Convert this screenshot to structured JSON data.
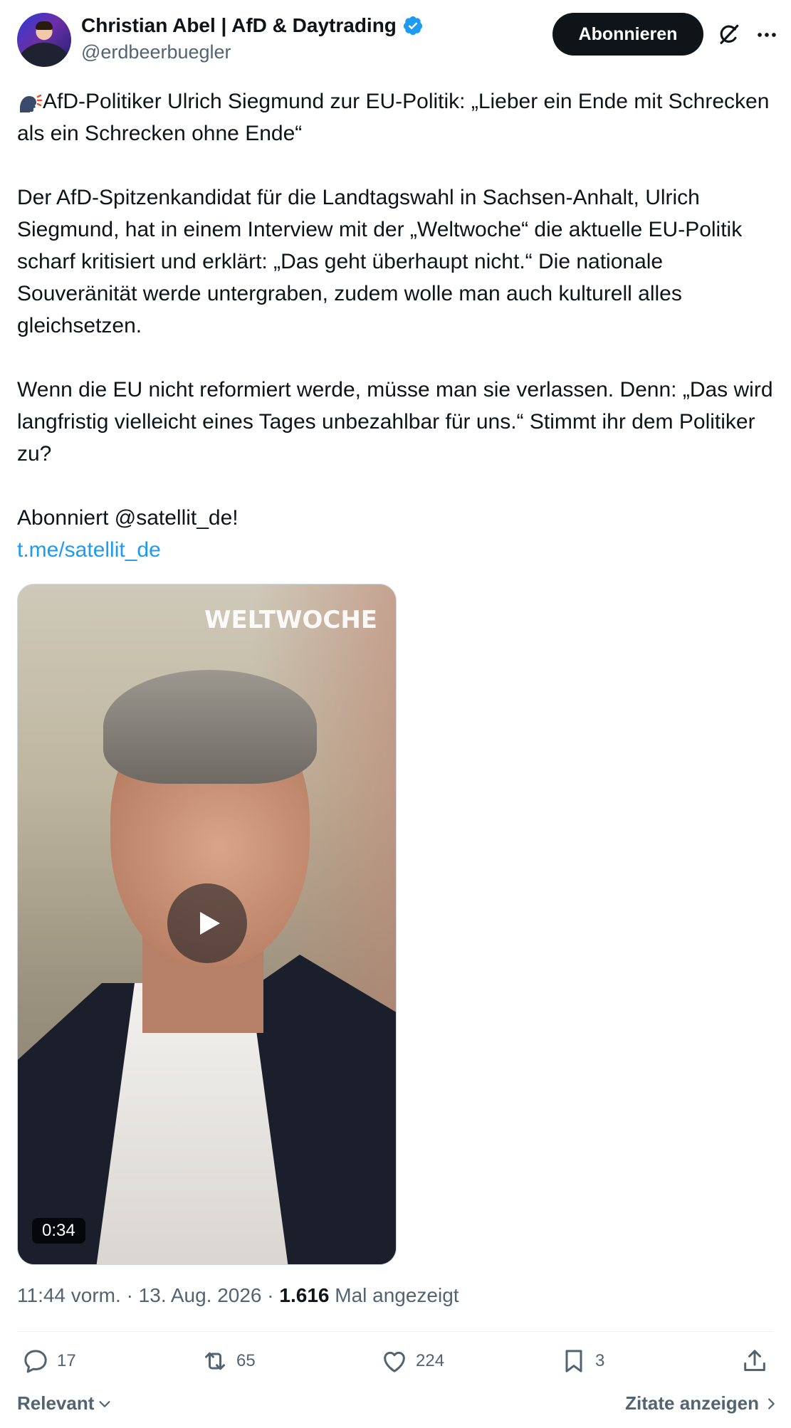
{
  "author": {
    "name": "Christian Abel | AfD & Daytrading",
    "handle": "@erdbeerbuegler"
  },
  "header": {
    "subscribe_label": "Abonnieren"
  },
  "tweet": {
    "line1": "AfD-Politiker Ulrich Siegmund zur EU-Politik: „Lieber ein Ende mit Schrecken als ein Schrecken ohne Ende“",
    "para2": "Der AfD-Spitzenkandidat für die Landtagswahl in Sachsen-Anhalt, Ulrich Siegmund, hat in einem Interview mit der „Weltwoche“ die aktuelle EU-Politik scharf kritisiert und erklärt: „Das geht überhaupt nicht.“ Die nationale Souveränität werde untergraben, zudem wolle man auch kulturell alles gleichsetzen.",
    "para3": "Wenn die EU nicht reformiert werde, müsse man sie verlassen. Denn: „Das wird langfristig vielleicht eines Tages unbezahlbar für uns.“ Stimmt ihr dem Politiker zu?",
    "para4": "Abonniert @satellit_de!",
    "link": "t.me/satellit_de"
  },
  "video": {
    "watermark": "WELTWOCHE",
    "duration": "0:34"
  },
  "meta": {
    "time": "11:44 vorm.",
    "date": "13. Aug. 2026",
    "views": "1.616",
    "views_label": "Mal angezeigt"
  },
  "actions": {
    "replies": "17",
    "reposts": "65",
    "likes": "224",
    "bookmarks": "3"
  },
  "footer": {
    "sort_label": "Relevant",
    "quotes_label": "Zitate anzeigen"
  },
  "colors": {
    "accent": "#1d9bf0",
    "text": "#0f1419",
    "muted": "#536471"
  }
}
